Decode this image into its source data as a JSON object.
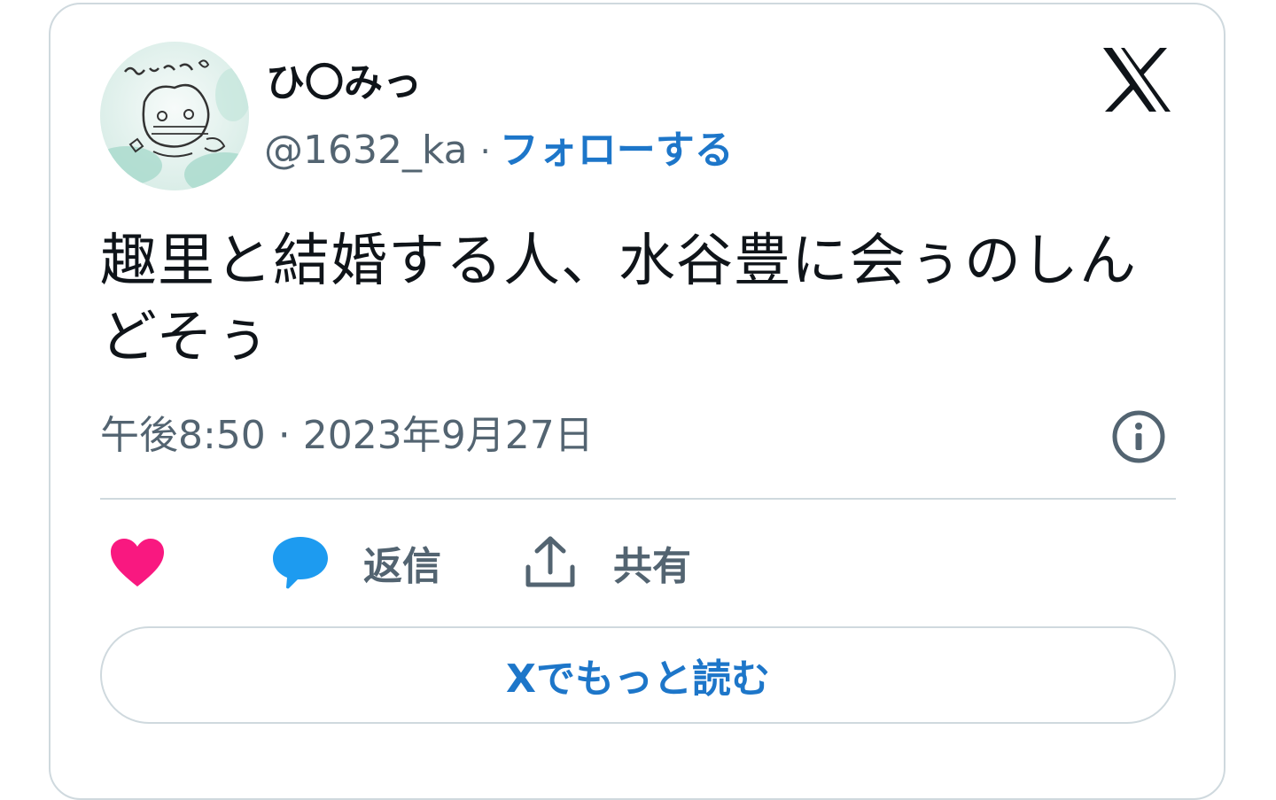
{
  "author": {
    "display_name": "ひ〇みっ",
    "handle": "@1632_ka",
    "separator": "·",
    "follow_label": "フォローする",
    "avatar_icon": "avatar-image"
  },
  "tweet": {
    "text": "趣里と結婚する人、水谷豊に会ぅのしんどそぅ",
    "timestamp": "午後8:50 · 2023年9月27日"
  },
  "actions": {
    "like_icon": "heart-icon",
    "reply_label": "返信",
    "share_label": "共有"
  },
  "read_more_label": "Xでもっと読む",
  "colors": {
    "accent": "#1d76c9",
    "like": "#f91880",
    "reply": "#1d9bf0",
    "muted": "#536471",
    "border": "#cfd9de"
  }
}
